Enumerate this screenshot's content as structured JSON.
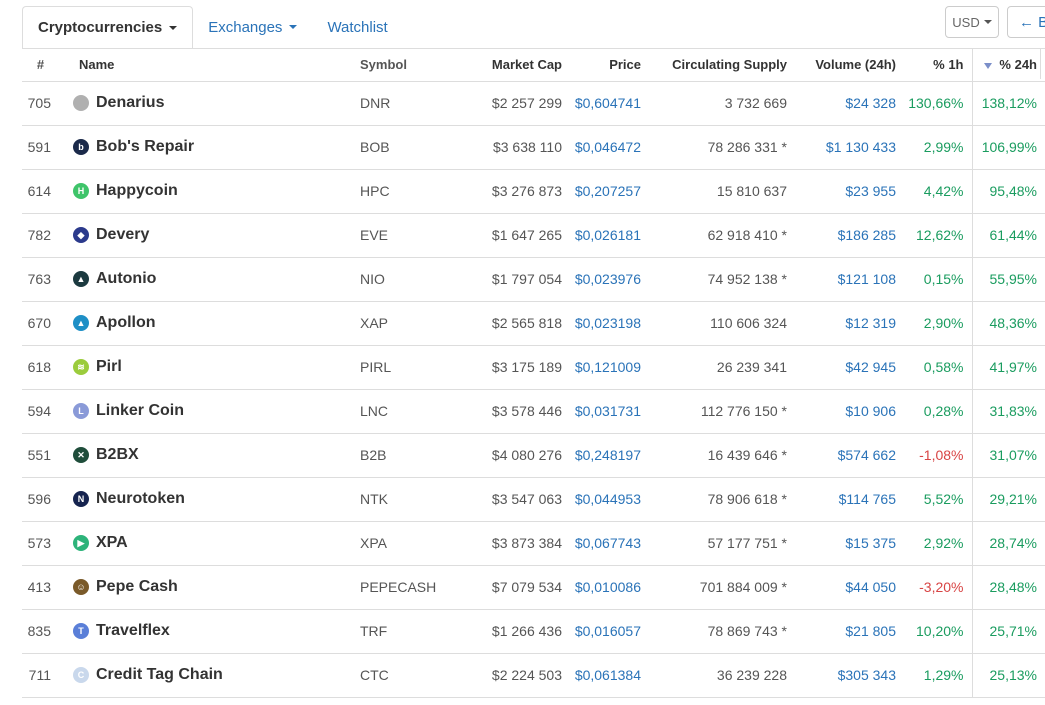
{
  "tabs": [
    {
      "label": "Cryptocurrencies",
      "active": true,
      "dropdown": true
    },
    {
      "label": "Exchanges",
      "active": false,
      "dropdown": true
    },
    {
      "label": "Watchlist",
      "active": false,
      "dropdown": false
    }
  ],
  "currency_selector": {
    "value": "USD"
  },
  "back_button": {
    "label": "← B"
  },
  "columns": [
    "#",
    "Name",
    "Symbol",
    "Market Cap",
    "Price",
    "Circulating Supply",
    "Volume (24h)",
    "% 1h",
    "% 24h"
  ],
  "colors": {
    "link": "#2a73b8",
    "positive": "#1a9c5f",
    "negative": "#d84444",
    "border": "#dddddd"
  },
  "rows": [
    {
      "rank": "705",
      "name": "Denarius",
      "symbol": "DNR",
      "market_cap": "$2 257 299",
      "price": "$0,604741",
      "supply": "3 732 669",
      "volume": "$24 328",
      "change_1h": "130,66%",
      "change_24h": "138,12%",
      "icon": "denarius-coin-icon",
      "icon_color": "#b0b0b0",
      "icon_glyph": ""
    },
    {
      "rank": "591",
      "name": "Bob's Repair",
      "symbol": "BOB",
      "market_cap": "$3 638 110",
      "price": "$0,046472",
      "supply": "78 286 331 *",
      "volume": "$1 130 433",
      "change_1h": "2,99%",
      "change_24h": "106,99%",
      "icon": "bobs-repair-icon",
      "icon_color": "#1b2a4a",
      "icon_glyph": "b"
    },
    {
      "rank": "614",
      "name": "Happycoin",
      "symbol": "HPC",
      "market_cap": "$3 276 873",
      "price": "$0,207257",
      "supply": "15 810 637",
      "volume": "$23 955",
      "change_1h": "4,42%",
      "change_24h": "95,48%",
      "icon": "happycoin-icon",
      "icon_color": "#3fc46a",
      "icon_glyph": "H"
    },
    {
      "rank": "782",
      "name": "Devery",
      "symbol": "EVE",
      "market_cap": "$1 647 265",
      "price": "$0,026181",
      "supply": "62 918 410 *",
      "volume": "$186 285",
      "change_1h": "12,62%",
      "change_24h": "61,44%",
      "icon": "devery-icon",
      "icon_color": "#2b3a8c",
      "icon_glyph": "◆"
    },
    {
      "rank": "763",
      "name": "Autonio",
      "symbol": "NIO",
      "market_cap": "$1 797 054",
      "price": "$0,023976",
      "supply": "74 952 138 *",
      "volume": "$121 108",
      "change_1h": "0,15%",
      "change_24h": "55,95%",
      "icon": "autonio-icon",
      "icon_color": "#1c3a40",
      "icon_glyph": "▲"
    },
    {
      "rank": "670",
      "name": "Apollon",
      "symbol": "XAP",
      "market_cap": "$2 565 818",
      "price": "$0,023198",
      "supply": "110 606 324",
      "volume": "$12 319",
      "change_1h": "2,90%",
      "change_24h": "48,36%",
      "icon": "apollon-icon",
      "icon_color": "#1e8fc6",
      "icon_glyph": "▲"
    },
    {
      "rank": "618",
      "name": "Pirl",
      "symbol": "PIRL",
      "market_cap": "$3 175 189",
      "price": "$0,121009",
      "supply": "26 239 341",
      "volume": "$42 945",
      "change_1h": "0,58%",
      "change_24h": "41,97%",
      "icon": "pirl-icon",
      "icon_color": "#9bcc3c",
      "icon_glyph": "≋"
    },
    {
      "rank": "594",
      "name": "Linker Coin",
      "symbol": "LNC",
      "market_cap": "$3 578 446",
      "price": "$0,031731",
      "supply": "112 776 150 *",
      "volume": "$10 906",
      "change_1h": "0,28%",
      "change_24h": "31,83%",
      "icon": "linker-coin-icon",
      "icon_color": "#8a9ad8",
      "icon_glyph": "L"
    },
    {
      "rank": "551",
      "name": "B2BX",
      "symbol": "B2B",
      "market_cap": "$4 080 276",
      "price": "$0,248197",
      "supply": "16 439 646 *",
      "volume": "$574 662",
      "change_1h": "-1,08%",
      "change_24h": "31,07%",
      "icon": "b2bx-icon",
      "icon_color": "#1f4d3b",
      "icon_glyph": "✕"
    },
    {
      "rank": "596",
      "name": "Neurotoken",
      "symbol": "NTK",
      "market_cap": "$3 547 063",
      "price": "$0,044953",
      "supply": "78 906 618 *",
      "volume": "$114 765",
      "change_1h": "5,52%",
      "change_24h": "29,21%",
      "icon": "neurotoken-icon",
      "icon_color": "#16244f",
      "icon_glyph": "N"
    },
    {
      "rank": "573",
      "name": "XPA",
      "symbol": "XPA",
      "market_cap": "$3 873 384",
      "price": "$0,067743",
      "supply": "57 177 751 *",
      "volume": "$15 375",
      "change_1h": "2,92%",
      "change_24h": "28,74%",
      "icon": "xpa-icon",
      "icon_color": "#2db37a",
      "icon_glyph": "▶"
    },
    {
      "rank": "413",
      "name": "Pepe Cash",
      "symbol": "PEPECASH",
      "market_cap": "$7 079 534",
      "price": "$0,010086",
      "supply": "701 884 009 *",
      "volume": "$44 050",
      "change_1h": "-3,20%",
      "change_24h": "28,48%",
      "icon": "pepe-cash-icon",
      "icon_color": "#7a5a2a",
      "icon_glyph": "☺"
    },
    {
      "rank": "835",
      "name": "Travelflex",
      "symbol": "TRF",
      "market_cap": "$1 266 436",
      "price": "$0,016057",
      "supply": "78 869 743 *",
      "volume": "$21 805",
      "change_1h": "10,20%",
      "change_24h": "25,71%",
      "icon": "travelflex-icon",
      "icon_color": "#5a7fd8",
      "icon_glyph": "T"
    },
    {
      "rank": "711",
      "name": "Credit Tag Chain",
      "symbol": "CTC",
      "market_cap": "$2 224 503",
      "price": "$0,061384",
      "supply": "36 239 228",
      "volume": "$305 343",
      "change_1h": "1,29%",
      "change_24h": "25,13%",
      "icon": "credit-tag-chain-icon",
      "icon_color": "#c9d8ec",
      "icon_glyph": "C"
    }
  ]
}
